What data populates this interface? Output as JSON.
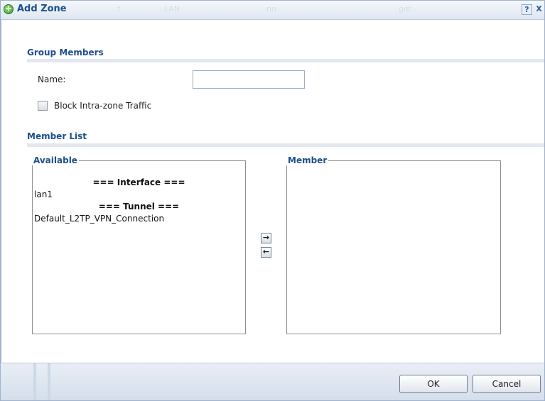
{
  "dialog": {
    "title": "Add Zone",
    "ghost_text": [
      "f",
      "LAN",
      "no",
      "get"
    ],
    "help_label": "?",
    "close_label": "X",
    "colors": {
      "title_text": "#1d4f8c",
      "accent_icon": "#2f9a2a"
    }
  },
  "group_members": {
    "heading": "Group Members",
    "name_label": "Name:",
    "name_value": "",
    "name_placeholder": "",
    "block_traffic_label": "Block Intra-zone Traffic",
    "block_traffic_checked": false
  },
  "member_list": {
    "heading": "Member List",
    "available": {
      "legend": "Available",
      "items": [
        {
          "type": "header",
          "text": "=== Interface ==="
        },
        {
          "type": "item",
          "text": "lan1"
        },
        {
          "type": "header",
          "text": "=== Tunnel ==="
        },
        {
          "type": "item",
          "text": "Default_L2TP_VPN_Connection"
        }
      ]
    },
    "member": {
      "legend": "Member",
      "items": []
    },
    "move_right_icon": "arrow-right",
    "move_left_icon": "arrow-left"
  },
  "footer": {
    "ok_label": "OK",
    "cancel_label": "Cancel"
  }
}
